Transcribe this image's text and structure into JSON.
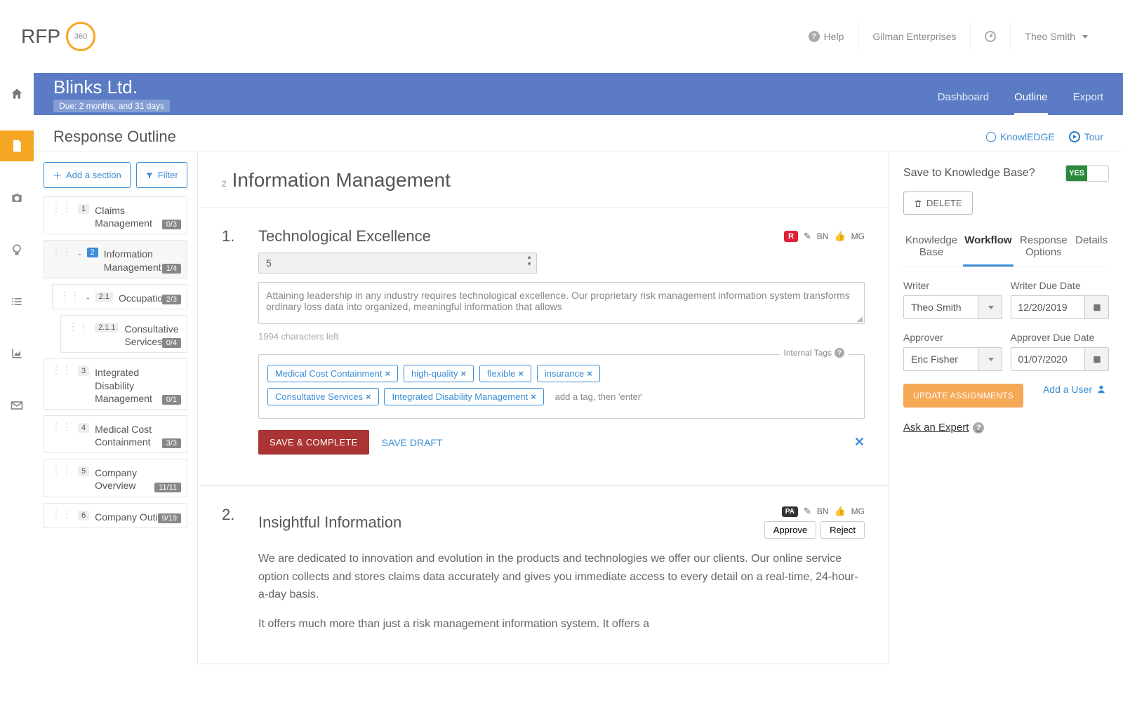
{
  "header": {
    "help": "Help",
    "org": "Gilman Enterprises",
    "user": "Theo Smith"
  },
  "company": {
    "name": "Blinks Ltd.",
    "due": "Due: 2 months, and 31 days",
    "nav": {
      "dashboard": "Dashboard",
      "outline": "Outline",
      "export": "Export"
    }
  },
  "subheader": {
    "title": "Response Outline",
    "knowledge": "KnowlEDGE",
    "tour": "Tour"
  },
  "outline": {
    "add": "Add a section",
    "filter": "Filter",
    "items": [
      {
        "num": "1",
        "title": "Claims Management",
        "count": "0/3"
      },
      {
        "num": "2",
        "title": "Information Management",
        "count": "1/4"
      },
      {
        "num": "2.1",
        "title": "Occupation",
        "count": "2/3"
      },
      {
        "num": "2.1.1",
        "title": "Consultative Services",
        "count": "0/4"
      },
      {
        "num": "3",
        "title": "Integrated Disability Management",
        "count": "0/1"
      },
      {
        "num": "4",
        "title": "Medical Cost Containment",
        "count": "3/3"
      },
      {
        "num": "5",
        "title": "Company Overview",
        "count": "11/11"
      },
      {
        "num": "6",
        "title": "Company Outing",
        "count": "9/19"
      }
    ]
  },
  "section": {
    "num": "2",
    "title": "Information Management"
  },
  "q1": {
    "num": "1.",
    "title": "Technological Excellence",
    "status": "R",
    "editor": "BN",
    "approver": "MG",
    "selectValue": "5",
    "text": "Attaining leadership in any industry requires technological excellence. Our proprietary risk management information system transforms ordinary loss data into organized, meaningful information that allows",
    "charLeft": "1994 characters left",
    "tagsLabel": "Internal Tags",
    "tags": [
      "Medical Cost Containment",
      "high-quality",
      "flexible",
      "insurance",
      "Consultative Services",
      "Integrated Disability Management"
    ],
    "tagHint": "add a tag, then 'enter'",
    "save": "SAVE & COMPLETE",
    "draft": "SAVE DRAFT"
  },
  "q2": {
    "num": "2.",
    "title": "Insightful Information",
    "status": "PA",
    "editor": "BN",
    "approver": "MG",
    "approve": "Approve",
    "reject": "Reject",
    "para1": "We are dedicated to innovation and evolution in the products and technologies we offer our clients. Our online service option collects and stores claims data accurately and gives you immediate access to every detail on a real-time, 24-hour-a-day basis.",
    "para2": "It offers much more than just a risk management information system. It offers a"
  },
  "right": {
    "saveKb": "Save to Knowledge Base?",
    "yes": "YES",
    "delete": "DELETE",
    "tabs": {
      "kb": "Knowledge Base",
      "wf": "Workflow",
      "ro": "Response Options",
      "det": "Details"
    },
    "writerLabel": "Writer",
    "writerDueLabel": "Writer Due Date",
    "writer": "Theo Smith",
    "writerDue": "12/20/2019",
    "approverLabel": "Approver",
    "approverDueLabel": "Approver Due Date",
    "approverName": "Eric Fisher",
    "approverDue": "01/07/2020",
    "update": "UPDATE ASSIGNMENTS",
    "addUser": "Add a User",
    "ask": "Ask an Expert"
  }
}
